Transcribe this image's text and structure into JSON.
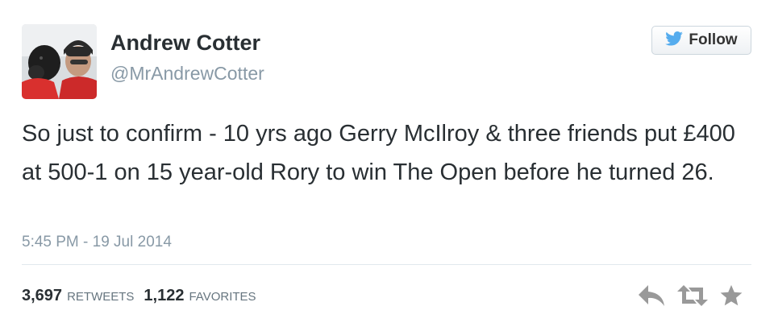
{
  "author": {
    "display_name": "Andrew Cotter",
    "handle": "@MrAndrewCotter"
  },
  "follow_button": {
    "label": "Follow"
  },
  "tweet": {
    "text": "So just to confirm - 10 yrs ago Gerry McIlroy & three friends put £400 at 500-1 on 15 year-old Rory to win The Open before he turned 26.",
    "timestamp": "5:45 PM - 19 Jul 2014"
  },
  "stats": {
    "retweets_count": "3,697",
    "retweets_label": "RETWEETS",
    "favorites_count": "1,122",
    "favorites_label": "FAVORITES"
  },
  "icons": {
    "follow": "bird-icon",
    "reply": "reply-icon",
    "retweet": "retweet-icon",
    "favorite": "star-icon"
  },
  "colors": {
    "brand_blue": "#55acee",
    "text": "#292f33",
    "muted": "#8899a6",
    "icon_gray": "#999999"
  }
}
